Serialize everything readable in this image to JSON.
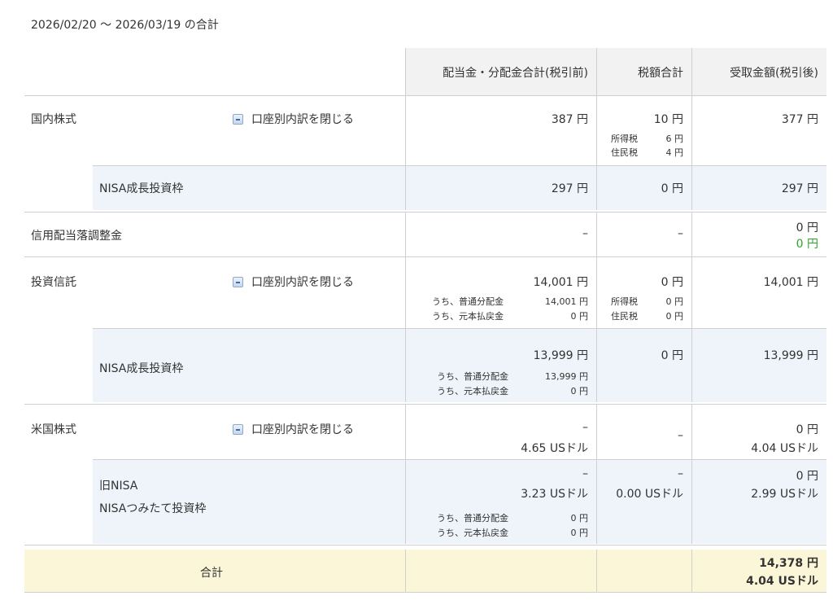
{
  "period": "2026/02/20 〜 2026/03/19 の合計",
  "headers": {
    "dividend": "配当金・分配金合計(税引前)",
    "tax": "税額合計",
    "received": "受取金額(税引後)"
  },
  "toggle_label": "口座別内訳を閉じる",
  "domestic": {
    "label": "国内株式",
    "dividend": "387 円",
    "tax": "10 円",
    "tax_income_label": "所得税",
    "tax_income": "6 円",
    "tax_resident_label": "住民税",
    "tax_resident": "4 円",
    "received": "377 円",
    "nisa": {
      "label": "NISA成長投資枠",
      "dividend": "297 円",
      "tax": "0 円",
      "received": "297 円"
    }
  },
  "margin": {
    "label": "信用配当落調整金",
    "dividend": "–",
    "tax": "–",
    "received": "0 円",
    "received_green": "0 円"
  },
  "fund": {
    "label": "投資信託",
    "dividend": "14,001 円",
    "ordinary_label": "うち、普通分配金",
    "ordinary": "14,001 円",
    "return_label": "うち、元本払戻金",
    "return": "0 円",
    "tax": "0 円",
    "tax_income_label": "所得税",
    "tax_income": "0 円",
    "tax_resident_label": "住民税",
    "tax_resident": "0 円",
    "received": "14,001 円",
    "nisa": {
      "label": "NISA成長投資枠",
      "dividend": "13,999 円",
      "ordinary_label": "うち、普通分配金",
      "ordinary": "13,999 円",
      "return_label": "うち、元本払戻金",
      "return": "0 円",
      "tax": "0 円",
      "received": "13,999 円"
    }
  },
  "us": {
    "label": "米国株式",
    "dividend": "–",
    "dividend_usd": "4.65 USドル",
    "tax": "–",
    "received": "0 円",
    "received_usd": "4.04 USドル",
    "nisa": {
      "label1": "旧NISA",
      "label2": "NISAつみたて投資枠",
      "dividend": "–",
      "dividend_usd": "3.23 USドル",
      "ordinary_label": "うち、普通分配金",
      "ordinary": "0 円",
      "return_label": "うち、元本払戻金",
      "return": "0 円",
      "tax": "–",
      "tax_usd": "0.00 USドル",
      "received": "0 円",
      "received_usd": "2.99 USドル"
    }
  },
  "total": {
    "label": "合計",
    "received": "14,378 円",
    "received_usd": "4.04 USドル"
  }
}
